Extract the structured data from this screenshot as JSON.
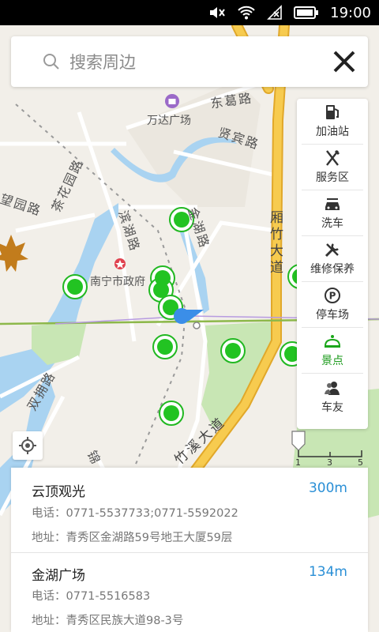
{
  "status_bar": {
    "time": "19:00"
  },
  "search": {
    "placeholder": "搜索周边"
  },
  "map_labels": {
    "donge_rd": "东葛路",
    "wanda": "万达广场",
    "xianbin_rd": "贤宾路",
    "chahuayuan_rd": "茶花园路",
    "wangyuan_rd": "望园路",
    "binhu_rd": "滨湖路",
    "jinhu_rd": "金湖路",
    "xiangzhu_ave": "厢竹大道",
    "govt": "南宁市政府",
    "shuangyong_rd": "双拥路",
    "zhuxi_ave": "竹溪大道",
    "jin_rd": "锦"
  },
  "categories": [
    {
      "label": "加油站",
      "icon": "gas-station-icon"
    },
    {
      "label": "服务区",
      "icon": "fork-knife-icon"
    },
    {
      "label": "洗车",
      "icon": "car-wash-icon"
    },
    {
      "label": "维修保养",
      "icon": "tools-icon"
    },
    {
      "label": "停车场",
      "icon": "parking-icon"
    },
    {
      "label": "景点",
      "icon": "scenic-icon",
      "active": true
    },
    {
      "label": "车友",
      "icon": "friends-icon"
    }
  ],
  "scale": {
    "ticks": [
      "1",
      "3",
      "5"
    ]
  },
  "results": [
    {
      "name": "云顶观光",
      "distance": "300m",
      "phone": "电话：0771-5537733;0771-5592022",
      "address": "地址：青秀区金湖路59号地王大厦59层"
    },
    {
      "name": "金湖广场",
      "distance": "134m",
      "phone": "电话：0771-5516583",
      "address": "地址：青秀区民族大道98-3号"
    }
  ],
  "colors": {
    "accent_green": "#1aa61a",
    "distance_blue": "#2a8fd6",
    "road_yellow": "#f5c242",
    "water": "#a9d3f1",
    "park": "#c8e6b4"
  }
}
